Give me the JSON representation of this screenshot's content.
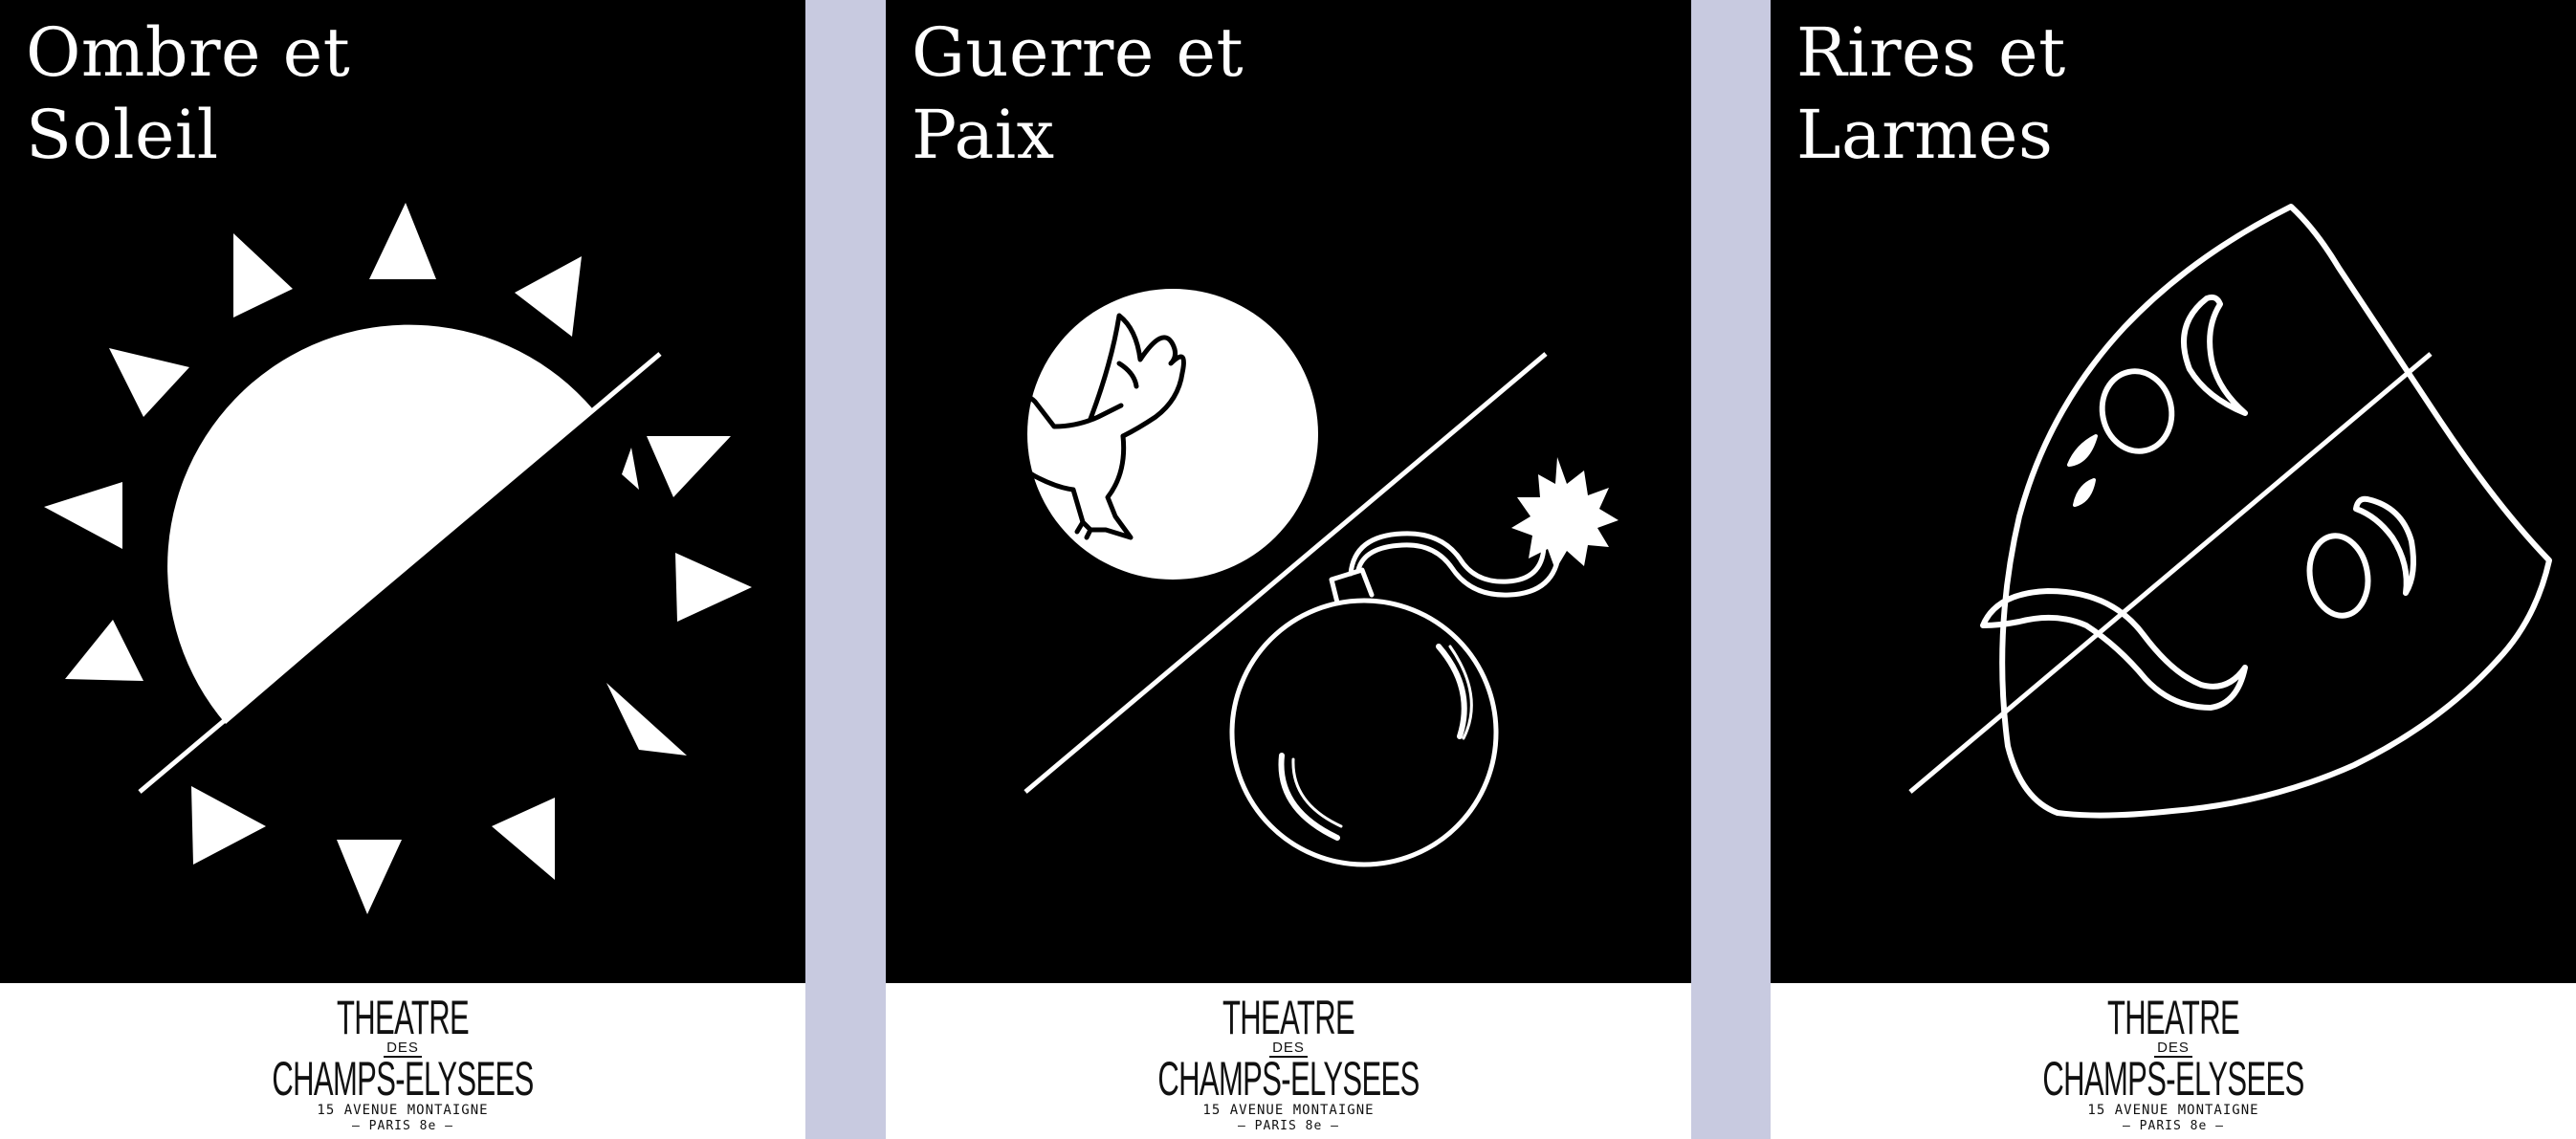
{
  "posters": [
    {
      "title_line1": "Ombre et",
      "title_line2": "Soleil",
      "illustration": "sun-icon"
    },
    {
      "title_line1": "Guerre et",
      "title_line2": "Paix",
      "illustration": "dove-and-bomb-icon"
    },
    {
      "title_line1": "Rires et",
      "title_line2": "Larmes",
      "illustration": "theatre-mask-icon"
    }
  ],
  "footer": {
    "logo_line1": "THEATRE",
    "logo_des": "DES",
    "logo_line2": "CHAMPS-ELYSEES",
    "address": "15 AVENUE MONTAIGNE",
    "city": "— PARIS 8e —"
  },
  "colors": {
    "poster_background": "#000000",
    "page_background": "#c8cae0",
    "art": "#ffffff",
    "footer_background": "#ffffff"
  }
}
